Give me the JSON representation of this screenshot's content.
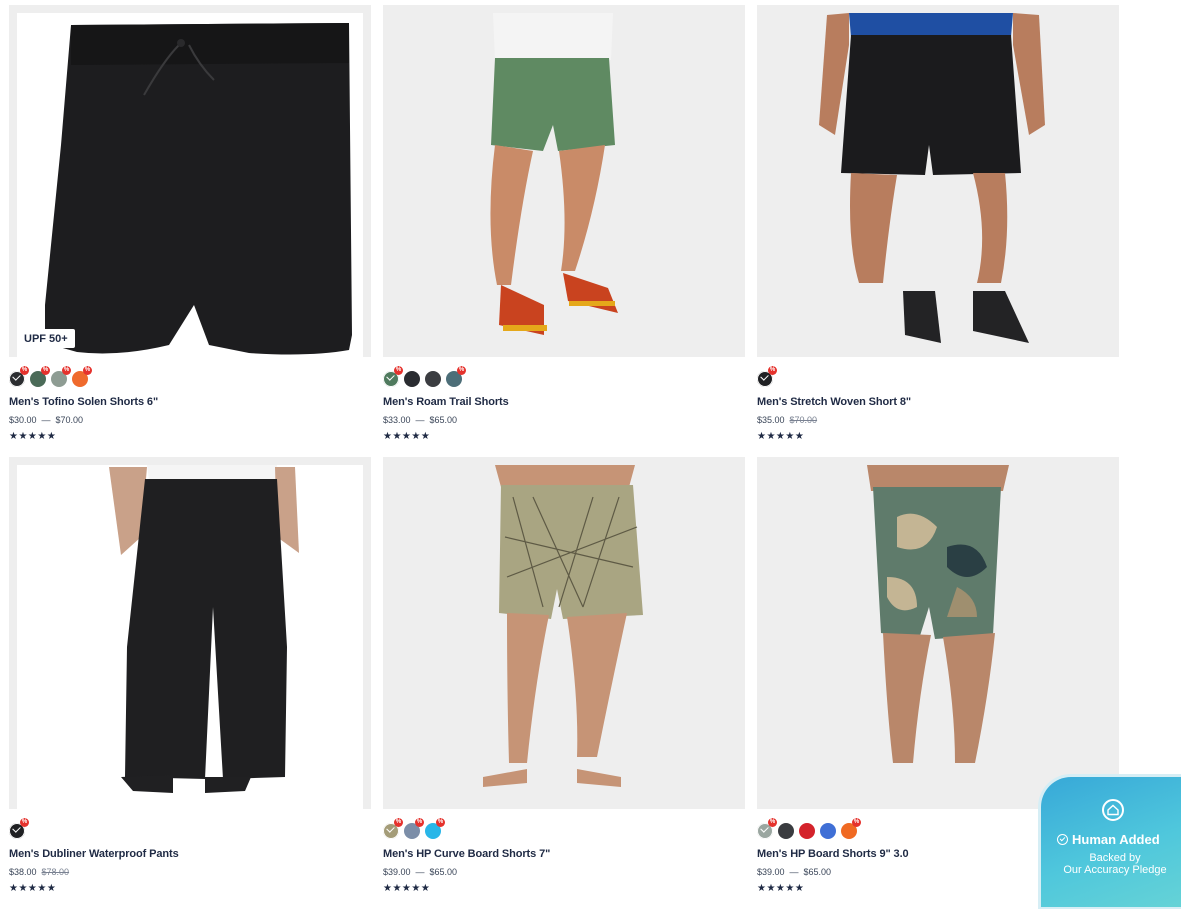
{
  "products": [
    {
      "name": "Men's Tofino Solen Shorts 6\"",
      "badge": "UPF 50+",
      "price_low": "$30.00",
      "price_sep": "—",
      "price_high": "$70.00",
      "price_was": "",
      "rating_stars": "★★★★★",
      "swatches": [
        {
          "color": "#2b2d30",
          "selected": true,
          "sale": true
        },
        {
          "color": "#4b6b58",
          "selected": false,
          "sale": true
        },
        {
          "color": "#8e9c93",
          "selected": false,
          "sale": true
        },
        {
          "color": "#ef6a2d",
          "selected": false,
          "sale": true
        }
      ]
    },
    {
      "name": "Men's Roam Trail Shorts",
      "badge": "",
      "price_low": "$33.00",
      "price_sep": "—",
      "price_high": "$65.00",
      "price_was": "",
      "rating_stars": "★★★★★",
      "swatches": [
        {
          "color": "#4f7a5e",
          "selected": true,
          "sale": true
        },
        {
          "color": "#2a2c31",
          "selected": false,
          "sale": false
        },
        {
          "color": "#3b3d41",
          "selected": false,
          "sale": false
        },
        {
          "color": "#4d6e78",
          "selected": false,
          "sale": true
        }
      ]
    },
    {
      "name": "Men's Stretch Woven Short 8\"",
      "badge": "",
      "price_low": "$35.00",
      "price_sep": "",
      "price_high": "",
      "price_was": "$70.00",
      "rating_stars": "★★★★★",
      "swatches": [
        {
          "color": "#1f2023",
          "selected": true,
          "sale": true
        }
      ]
    },
    {
      "name": "Men's Dubliner Waterproof Pants",
      "badge": "",
      "price_low": "$38.00",
      "price_sep": "",
      "price_high": "",
      "price_was": "$78.00",
      "rating_stars": "★★★★★",
      "swatches": [
        {
          "color": "#1f2023",
          "selected": true,
          "sale": true
        }
      ]
    },
    {
      "name": "Men's HP Curve Board Shorts 7\"",
      "badge": "",
      "price_low": "$39.00",
      "price_sep": "—",
      "price_high": "$65.00",
      "price_was": "",
      "rating_stars": "★★★★★",
      "swatches": [
        {
          "color": "#a49c78",
          "selected": true,
          "sale": true
        },
        {
          "color": "#7c8ea8",
          "selected": false,
          "sale": true
        },
        {
          "color": "#29b6e8",
          "selected": false,
          "sale": true
        }
      ]
    },
    {
      "name": "Men's HP Board Shorts 9\" 3.0",
      "badge": "",
      "price_low": "$39.00",
      "price_sep": "—",
      "price_high": "$65.00",
      "price_was": "",
      "rating_stars": "★★★★★",
      "swatches": [
        {
          "color": "#9aa6a0",
          "selected": true,
          "sale": true
        },
        {
          "color": "#3a3c40",
          "selected": false,
          "sale": false
        },
        {
          "color": "#d4232b",
          "selected": false,
          "sale": false
        },
        {
          "color": "#3f6fd6",
          "selected": false,
          "sale": false
        },
        {
          "color": "#f06a23",
          "selected": false,
          "sale": true
        }
      ]
    }
  ],
  "sale_badge_glyph": "%",
  "pledge": {
    "title": "Human Added",
    "line1": "Backed by",
    "line2": "Our Accuracy Pledge"
  }
}
